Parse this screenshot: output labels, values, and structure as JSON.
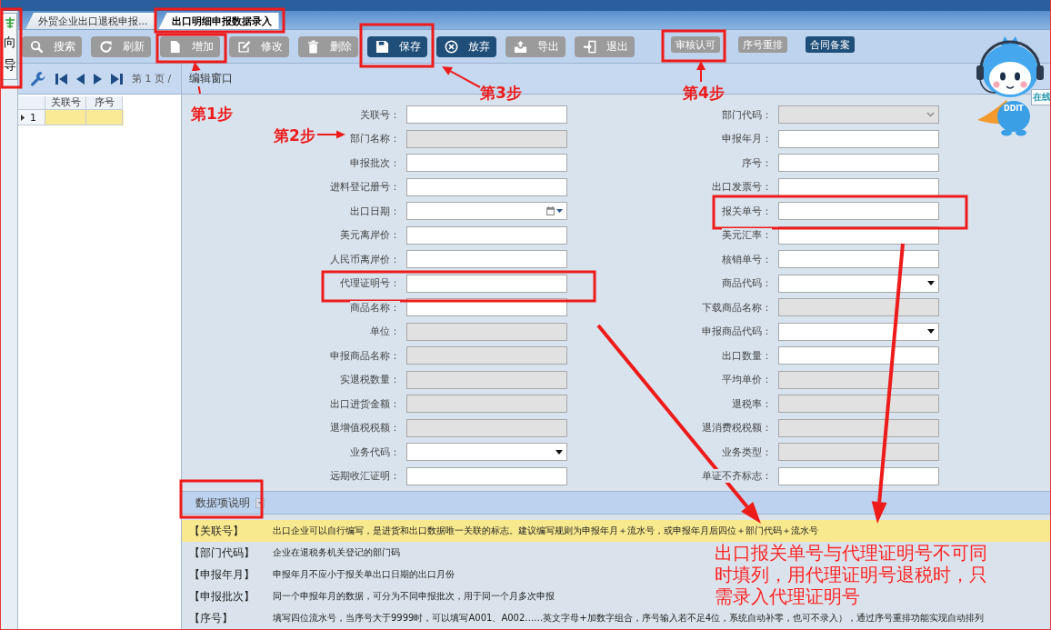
{
  "guide_tab": {
    "label": "向导"
  },
  "tabs": [
    {
      "label": "外贸企业出口退税申报...",
      "selected": false
    },
    {
      "label": "出口明细申报数据录入",
      "selected": true
    }
  ],
  "toolbar": [
    {
      "label": "搜索",
      "kind": "large",
      "disabled": true
    },
    {
      "label": "刷新",
      "kind": "large",
      "disabled": true
    },
    {
      "label": "增加",
      "kind": "large",
      "disabled": true
    },
    {
      "label": "修改",
      "kind": "large",
      "disabled": true
    },
    {
      "label": "删除",
      "kind": "large",
      "disabled": true
    },
    {
      "label": "保存",
      "kind": "large",
      "disabled": false
    },
    {
      "label": "放弃",
      "kind": "large",
      "disabled": false
    },
    {
      "label": "导出",
      "kind": "large",
      "disabled": true
    },
    {
      "label": "退出",
      "kind": "large",
      "disabled": true
    },
    {
      "label": "审核认可",
      "kind": "small",
      "disabled": true
    },
    {
      "label": "序号重排",
      "kind": "small",
      "disabled": true
    },
    {
      "label": "合同备案",
      "kind": "small",
      "disabled": false
    }
  ],
  "list_panel": {
    "page_label": "第 1 页 /",
    "columns": [
      "关联号",
      "序号"
    ],
    "rows": [
      {
        "row_number": "1",
        "selected": true
      }
    ]
  },
  "edit_panel": {
    "title": "编辑窗口",
    "left_fields": [
      {
        "label": "关联号：",
        "kind": "text",
        "disabled": false
      },
      {
        "label": "部门名称：",
        "kind": "text",
        "disabled": true
      },
      {
        "label": "申报批次：",
        "kind": "text",
        "disabled": false
      },
      {
        "label": "进料登记册号：",
        "kind": "text",
        "disabled": false
      },
      {
        "label": "出口日期：",
        "kind": "date",
        "disabled": false
      },
      {
        "label": "美元离岸价：",
        "kind": "text",
        "disabled": false
      },
      {
        "label": "人民币离岸价：",
        "kind": "text",
        "disabled": false
      },
      {
        "label": "代理证明号：",
        "kind": "text",
        "disabled": false
      },
      {
        "label": "商品名称：",
        "kind": "text",
        "disabled": false
      },
      {
        "label": "单位：",
        "kind": "text",
        "disabled": true
      },
      {
        "label": "申报商品名称：",
        "kind": "text",
        "disabled": true
      },
      {
        "label": "实退税数量：",
        "kind": "text",
        "disabled": true
      },
      {
        "label": "出口进货金额：",
        "kind": "text",
        "disabled": true
      },
      {
        "label": "退增值税税额：",
        "kind": "text",
        "disabled": true
      },
      {
        "label": "业务代码：",
        "kind": "select",
        "disabled": false
      },
      {
        "label": "远期收汇证明：",
        "kind": "text",
        "disabled": false
      }
    ],
    "right_fields": [
      {
        "label": "部门代码：",
        "kind": "select",
        "disabled": true
      },
      {
        "label": "申报年月：",
        "kind": "text",
        "disabled": false
      },
      {
        "label": "序号：",
        "kind": "text",
        "disabled": false
      },
      {
        "label": "出口发票号：",
        "kind": "text",
        "disabled": false
      },
      {
        "label": "报关单号：",
        "kind": "text",
        "disabled": false
      },
      {
        "label": "美元汇率：",
        "kind": "text",
        "disabled": false
      },
      {
        "label": "核销单号：",
        "kind": "text",
        "disabled": false
      },
      {
        "label": "商品代码：",
        "kind": "select",
        "disabled": false
      },
      {
        "label": "下载商品名称：",
        "kind": "text",
        "disabled": true
      },
      {
        "label": "申报商品代码：",
        "kind": "select",
        "disabled": false
      },
      {
        "label": "出口数量：",
        "kind": "text",
        "disabled": false
      },
      {
        "label": "平均单价：",
        "kind": "text",
        "disabled": true
      },
      {
        "label": "退税率：",
        "kind": "text",
        "disabled": true
      },
      {
        "label": "退消费税税额：",
        "kind": "text",
        "disabled": true
      },
      {
        "label": "业务类型：",
        "kind": "text",
        "disabled": true
      },
      {
        "label": "单证不齐标志：",
        "kind": "text",
        "disabled": false
      }
    ]
  },
  "help_panel": {
    "title": "数据项说明",
    "items": [
      {
        "label": "【关联号】",
        "text": "出口企业可以自行编写，是进货和出口数据唯一关联的标志。建议编写规则为申报年月＋流水号，或申报年月后四位＋部门代码＋流水号",
        "selected": true
      },
      {
        "label": "【部门代码】",
        "text": "企业在退税务机关登记的部门码",
        "selected": false
      },
      {
        "label": "【申报年月】",
        "text": "申报年月不应小于报关单出口日期的出口月份",
        "selected": false
      },
      {
        "label": "【申报批次】",
        "text": "同一个申报年月的数据，可分为不同申报批次，用于同一个月多次申报",
        "selected": false
      },
      {
        "label": "【序号】",
        "text": "填写四位流水号，当序号大于9999时，可以填写A001、A002……英文字母+加数字组合，序号输入若不足4位，系统自动补零，也可不录入），通过序号重排功能实现自动排列",
        "selected": false
      }
    ]
  },
  "mascot": {
    "badge": "DDIT",
    "chat_tab": "在线"
  },
  "annotations": {
    "steps": [
      "第1步",
      "第2步",
      "第3步",
      "第4步"
    ],
    "note": "出口报关单号与代理证明号不可同时填列，用代理证明号退税时，只需录入代理证明号"
  }
}
